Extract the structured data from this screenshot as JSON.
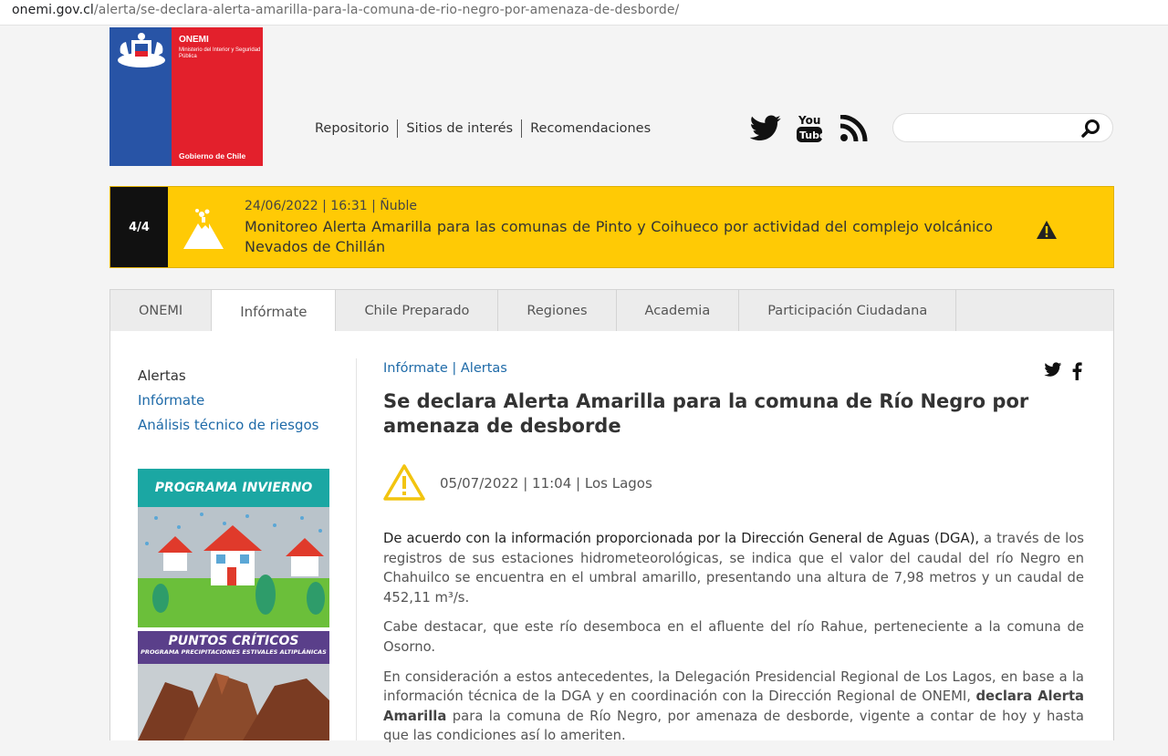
{
  "browser": {
    "url_domain": "onemi.gov.cl",
    "url_path": "/alerta/se-declara-alerta-amarilla-para-la-comuna-de-rio-negro-por-amenaza-de-desborde/"
  },
  "logo": {
    "name": "ONEMI",
    "subtitle": "Ministerio del Interior y Seguridad Pública",
    "footer": "Gobierno de Chile"
  },
  "top_nav": [
    "Repositorio",
    "Sitios de interés",
    "Recomendaciones"
  ],
  "social_icons": [
    "twitter-icon",
    "youtube-icon",
    "rss-icon"
  ],
  "search": {
    "placeholder": ""
  },
  "alert_ticker": {
    "counter": "4/4",
    "meta": "24/06/2022 | 16:31 | Ñuble",
    "text": "Monitoreo Alerta Amarilla para las comunas de Pinto y Coihueco por actividad del complejo volcánico Nevados de Chillán"
  },
  "tabs": [
    {
      "label": "ONEMI"
    },
    {
      "label": "Infórmate"
    },
    {
      "label": "Chile Preparado"
    },
    {
      "label": "Regiones"
    },
    {
      "label": "Academia"
    },
    {
      "label": "Participación Ciudadana"
    }
  ],
  "sidebar": {
    "items": [
      "Alertas",
      "Infórmate",
      "Análisis técnico de riesgos"
    ],
    "banner1": "PROGRAMA INVIERNO",
    "banner2_title": "PUNTOS CRÍTICOS",
    "banner2_sub": "PROGRAMA PRECIPITACIONES ESTIVALES ALTIPLÁNICAS"
  },
  "article": {
    "breadcrumb": "Infórmate | Alertas",
    "title": "Se declara Alerta Amarilla para la comuna de Río Negro por amenaza de desborde",
    "date": "05/07/2022 | 11:04 | Los Lagos",
    "p1_lead": "De acuerdo con la información proporcionada por la Dirección General de Aguas (DGA),",
    "p1_rest": " a través de los registros de sus estaciones hidrometeorológicas, se indica que el valor del caudal del río Negro en Chahuilco se encuentra en el umbral amarillo, presentando una altura de 7,98 metros y un caudal de 452,11 m³/s.",
    "p2": "Cabe destacar, que este río desemboca en el afluente del río Rahue, perteneciente a la comuna de Osorno.",
    "p3_a": "En consideración a estos antecedentes, la Delegación Presidencial Regional de Los Lagos, en base a la información técnica de la DGA y en coordinación con la Dirección Regional de ONEMI, ",
    "p3_bold": "declara Alerta Amarilla",
    "p3_b": " para la comuna de Río Negro, por amenaza de desborde, vigente a contar de hoy y hasta que las condiciones así lo ameriten."
  },
  "colors": {
    "alert_yellow": "#ffca05",
    "link_blue": "#1e6aa8",
    "gov_blue": "#2854a6",
    "gov_red": "#e3202c"
  }
}
